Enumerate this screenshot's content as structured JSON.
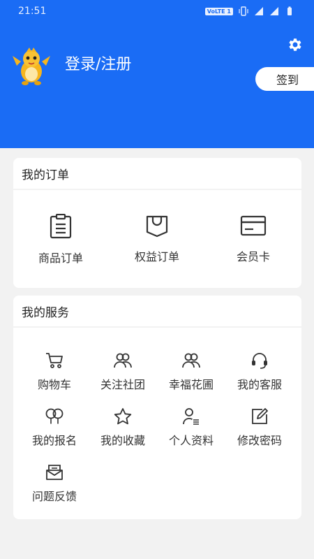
{
  "status_bar": {
    "time": "21:51",
    "volte": "VoLTE 1",
    "network": "4G"
  },
  "header": {
    "login_label": "登录/注册",
    "signin_label": "签到",
    "icons": [
      "gear-icon",
      "mascot-avatar"
    ]
  },
  "orders": {
    "title": "我的订单",
    "items": [
      {
        "label": "商品订单",
        "icon": "clipboard-icon"
      },
      {
        "label": "权益订单",
        "icon": "bookmark-smile-icon"
      },
      {
        "label": "会员卡",
        "icon": "card-icon"
      }
    ]
  },
  "services": {
    "title": "我的服务",
    "items": [
      {
        "label": "购物车",
        "icon": "cart-icon"
      },
      {
        "label": "关注社团",
        "icon": "group-icon"
      },
      {
        "label": "幸福花圃",
        "icon": "group-icon"
      },
      {
        "label": "我的客服",
        "icon": "headset-icon"
      },
      {
        "label": "我的报名",
        "icon": "balloons-icon"
      },
      {
        "label": "我的收藏",
        "icon": "star-icon"
      },
      {
        "label": "个人资料",
        "icon": "profile-icon"
      },
      {
        "label": "修改密码",
        "icon": "edit-icon"
      },
      {
        "label": "问题反馈",
        "icon": "feedback-icon"
      }
    ]
  },
  "colors": {
    "primary": "#1a6cf5",
    "background": "#f2f2f2",
    "card": "#ffffff"
  }
}
